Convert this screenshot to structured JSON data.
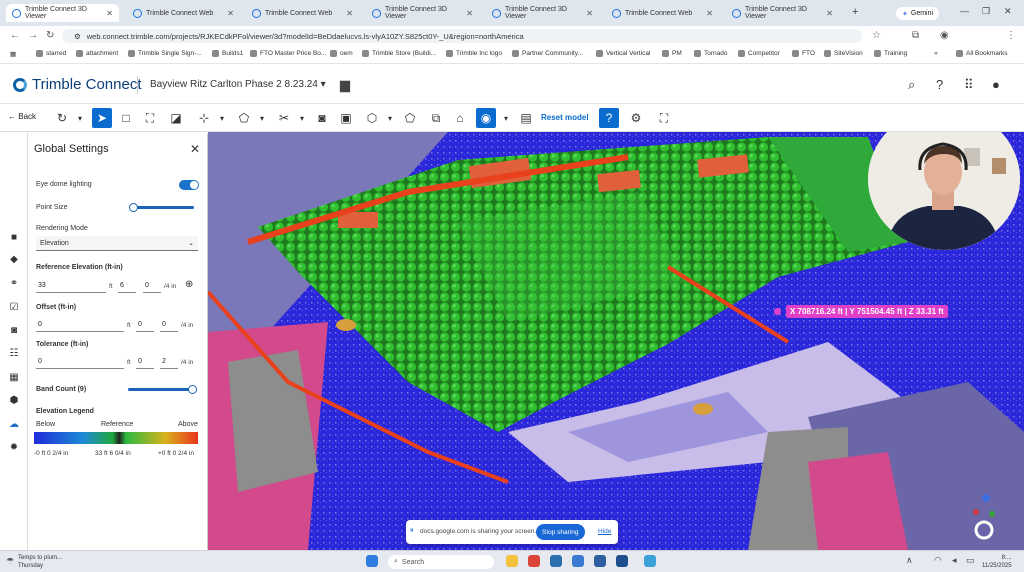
{
  "browser": {
    "tabs": [
      {
        "label": "Trimble Connect 3D Viewer",
        "active": true
      },
      {
        "label": "Trimble Connect Web",
        "active": false
      },
      {
        "label": "Trimble Connect Web",
        "active": false
      },
      {
        "label": "Trimble Connect 3D Viewer",
        "active": false
      },
      {
        "label": "Trimble Connect 3D Viewer",
        "active": false
      },
      {
        "label": "Trimble Connect Web",
        "active": false
      },
      {
        "label": "Trimble Connect 3D Viewer",
        "active": false
      }
    ],
    "new_tab": "+",
    "gemini_label": "Gemini",
    "url": "web.connect.trimble.com/projects/RJKECdkPFol/viewer/3d?modelId=BeDdaelucvs.ls-vlyA10ZY.S825ct0Y-_U&region=northAmerica",
    "bookmarks": [
      "starred",
      "attachment",
      "Trimble Single Sign-...",
      "Builds1",
      "FTO Master Price Bo...",
      "oem",
      "Trimble Store (Buildi...",
      "Trimble Inc logo",
      "Partner Community...",
      "Vertical Vertical",
      "PM",
      "Tornado",
      "Competitor",
      "FTO",
      "SiteVision",
      "Training"
    ],
    "all_bookmarks": "All Bookmarks"
  },
  "app": {
    "brand": "Trimble Connect",
    "project": "Bayview Ritz Carlton Phase 2 8.23.24"
  },
  "toolbar": {
    "back_label": "Back",
    "reset_label": "Reset model"
  },
  "settings": {
    "title": "Global Settings",
    "eye_dome_label": "Eye dome lighting",
    "eye_dome_on": true,
    "point_size_label": "Point Size",
    "point_size_level": 0.02,
    "rendering_mode_label": "Rendering Mode",
    "rendering_mode_value": "Elevation",
    "ref_elev_label": "Reference Elevation (ft-in)",
    "ref_elev": {
      "value": "33",
      "ft": "ft",
      "in": "6",
      "frac": "0",
      "frac_unit": "/4 in"
    },
    "offset_label": "Offset (ft-in)",
    "offset": {
      "value": "0",
      "ft": "ft",
      "in": "0",
      "frac": "0",
      "frac_unit": "/4 in"
    },
    "tolerance_label": "Tolerance (ft-in)",
    "tolerance": {
      "value": "0",
      "ft": "ft",
      "in": "0",
      "frac": "2",
      "frac_unit": "/4 in"
    },
    "band_count_label": "Band Count (9)",
    "band_count_level": 1.0,
    "legend_label": "Elevation Legend",
    "legend_below": "Below",
    "legend_reference": "Reference",
    "legend_above": "Above",
    "legend_min": "-0 ft 0 2/4 in",
    "legend_ref": "33 ft 6 0/4 in",
    "legend_max": "+0 ft 0 2/4 in"
  },
  "viewport": {
    "coordinate_readout": "X 708716.24 ft | Y 751504.45 ft | Z 33.31 ft"
  },
  "share_bar": {
    "message": "docs.google.com is sharing your screen.",
    "stop_label": "Stop sharing",
    "hide_label": "Hide"
  },
  "taskbar": {
    "weather_line1": "Temps to plum...",
    "weather_line2": "Thursday",
    "search_placeholder": "Search",
    "time": "8:...",
    "date": "11/25/2025"
  }
}
